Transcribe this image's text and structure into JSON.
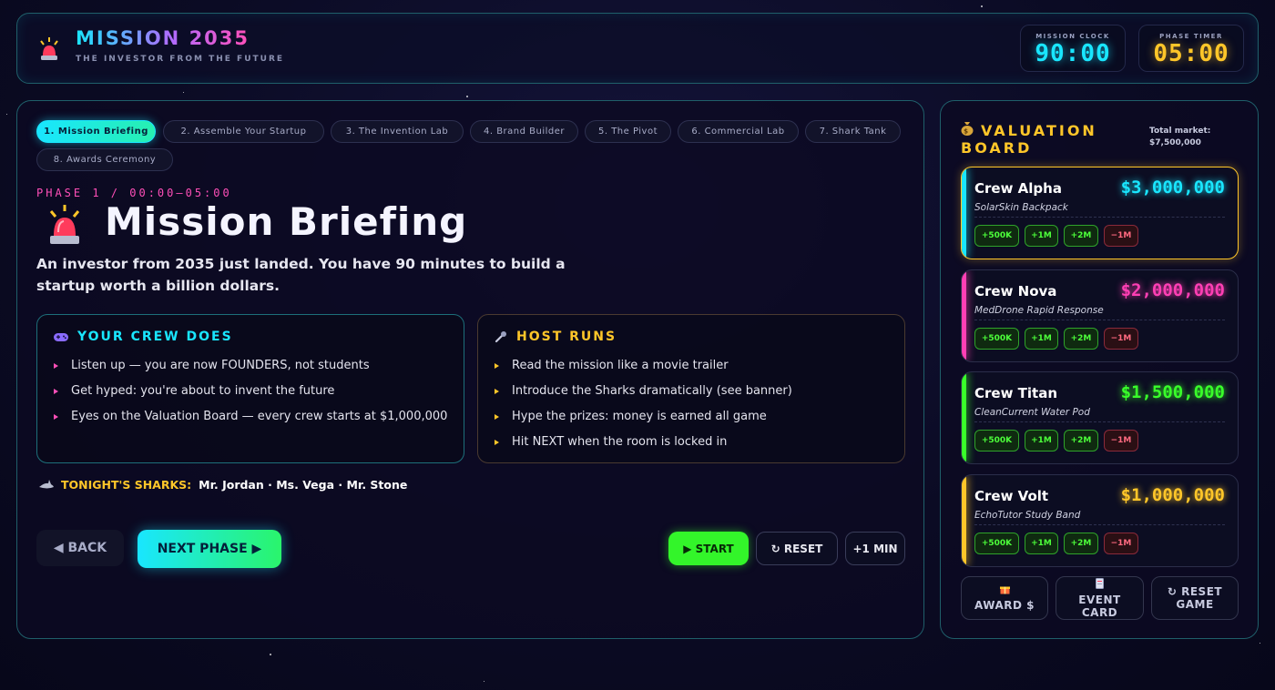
{
  "header": {
    "title": "MISSION 2035",
    "subtitle": "THE INVESTOR FROM THE FUTURE",
    "mission_clock": {
      "label": "MISSION CLOCK",
      "value": "90:00"
    },
    "phase_timer": {
      "label": "PHASE TIMER",
      "value": "05:00"
    }
  },
  "tabs": [
    {
      "label": "1. Mission Briefing",
      "active": true
    },
    {
      "label": "2. Assemble Your Startup",
      "active": false
    },
    {
      "label": "3. The Invention Lab",
      "active": false
    },
    {
      "label": "4. Brand Builder",
      "active": false
    },
    {
      "label": "5. The Pivot",
      "active": false
    },
    {
      "label": "6. Commercial Lab",
      "active": false
    },
    {
      "label": "7. Shark Tank",
      "active": false
    },
    {
      "label": "8. Awards Ceremony",
      "active": false
    }
  ],
  "phase": {
    "label": "PHASE 1 / 00:00–05:00",
    "title": "Mission Briefing",
    "icon": "siren-icon",
    "description": "An investor from 2035 just landed. You have 90 minutes to build a startup worth a billion dollars."
  },
  "crew_card": {
    "title": "YOUR CREW DOES",
    "icon": "gamepad-icon",
    "items": [
      "Listen up — you are now FOUNDERS, not students",
      "Get hyped: you're about to invent the future",
      "Eyes on the Valuation Board — every crew starts at $1,000,000"
    ]
  },
  "host_card": {
    "title": "HOST RUNS",
    "icon": "microphone-icon",
    "items": [
      "Read the mission like a movie trailer",
      "Introduce the Sharks dramatically (see banner)",
      "Hype the prizes: money is earned all game",
      "Hit NEXT when the room is locked in"
    ]
  },
  "sharks": {
    "label": "TONIGHT'S SHARKS:",
    "names": "Mr. Jordan · Ms. Vega · Mr. Stone"
  },
  "controls": {
    "back": "◀ BACK",
    "next": "NEXT PHASE ▶",
    "start": "▶ START",
    "reset": "↻ RESET",
    "add_minute": "+1 MIN"
  },
  "board": {
    "title": "VALUATION BOARD",
    "market_label": "Total market:",
    "market_value": "$7,500,000",
    "crews": [
      {
        "name": "Crew Alpha",
        "value": "$3,000,000",
        "product": "SolarSkin Backpack",
        "color": "#19e6ff",
        "leader": true
      },
      {
        "name": "Crew Nova",
        "value": "$2,000,000",
        "product": "MedDrone Rapid Response",
        "color": "#ff3fb4",
        "leader": false
      },
      {
        "name": "Crew Titan",
        "value": "$1,500,000",
        "product": "CleanCurrent Water Pod",
        "color": "#39ff2a",
        "leader": false
      },
      {
        "name": "Crew Volt",
        "value": "$1,000,000",
        "product": "EchoTutor Study Band",
        "color": "#ffc629",
        "leader": false
      }
    ],
    "chips": [
      "+500K",
      "+1M",
      "+2M",
      "−1M"
    ],
    "actions": [
      {
        "label": "AWARD $",
        "icon": "gift-icon"
      },
      {
        "label": "EVENT CARD",
        "icon": "card-icon"
      },
      {
        "label": "↻ RESET GAME",
        "icon": ""
      }
    ]
  }
}
